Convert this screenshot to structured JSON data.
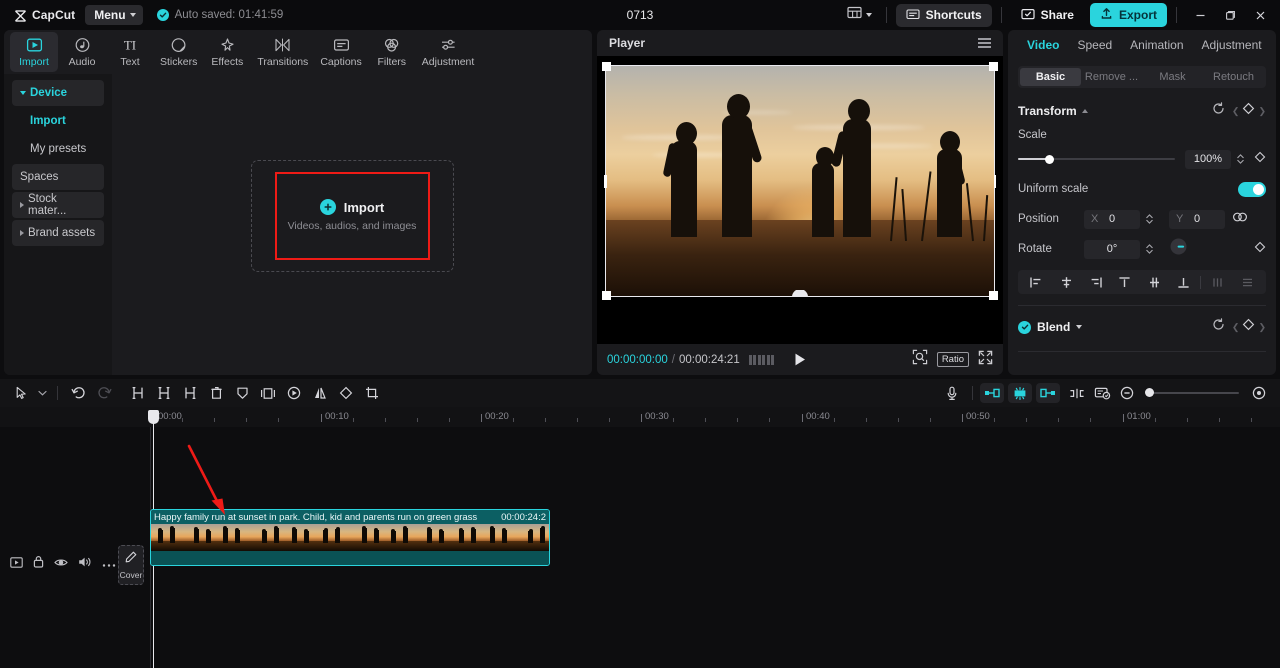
{
  "titlebar": {
    "brand": "CapCut",
    "menu_label": "Menu",
    "autosave_text": "Auto saved: 01:41:59",
    "project_title": "0713",
    "shortcuts_label": "Shortcuts",
    "share_label": "Share",
    "export_label": "Export",
    "icons": {
      "logo": "capcut-logo-icon",
      "autosave_check": "check-circle-icon",
      "layout": "layout-grid-icon",
      "shortcuts": "keyboard-icon",
      "share": "share-box-icon",
      "export": "upload-icon",
      "minimize": "minimize-icon",
      "maximize": "maximize-icon",
      "close": "close-icon"
    }
  },
  "media_tabs": [
    {
      "label": "Import",
      "icon": "import-media-icon",
      "active": true
    },
    {
      "label": "Audio",
      "icon": "audio-note-icon",
      "active": false
    },
    {
      "label": "Text",
      "icon": "text-ti-icon",
      "active": false
    },
    {
      "label": "Stickers",
      "icon": "sticker-icon",
      "active": false
    },
    {
      "label": "Effects",
      "icon": "effects-sparkle-icon",
      "active": false
    },
    {
      "label": "Transitions",
      "icon": "transitions-icon",
      "active": false
    },
    {
      "label": "Captions",
      "icon": "captions-icon",
      "active": false
    },
    {
      "label": "Filters",
      "icon": "filters-circles-icon",
      "active": false
    },
    {
      "label": "Adjustment",
      "icon": "adjustment-sliders-icon",
      "active": false
    }
  ],
  "media_sidebar": [
    {
      "label": "Device",
      "type": "group-open",
      "highlight": true
    },
    {
      "label": "Import",
      "type": "sub",
      "highlight": true
    },
    {
      "label": "My presets",
      "type": "sub",
      "highlight": false
    },
    {
      "label": "Spaces",
      "type": "box",
      "highlight": false
    },
    {
      "label": "Stock mater...",
      "type": "group-closed",
      "highlight": false
    },
    {
      "label": "Brand assets",
      "type": "group-closed",
      "highlight": false
    }
  ],
  "dropzone": {
    "import_label": "Import",
    "import_sub": "Videos, audios, and images",
    "plus_icon": "plus-circle-icon",
    "highlight_color": "#ef1b16"
  },
  "player": {
    "title": "Player",
    "menu_icon": "hamburger-menu-icon",
    "current_time": "00:00:00:00",
    "separator": "/",
    "total_time": "00:00:24:21",
    "frames_icon": "frames-icon",
    "play_icon": "play-icon",
    "zoom_icon": "zoom-fit-icon",
    "ratio_label": "Ratio",
    "fullscreen_icon": "fullscreen-icon"
  },
  "props": {
    "tabs": [
      {
        "label": "Video",
        "active": true
      },
      {
        "label": "Speed",
        "active": false
      },
      {
        "label": "Animation",
        "active": false
      },
      {
        "label": "Adjustment",
        "active": false
      }
    ],
    "subtabs": [
      {
        "label": "Basic",
        "active": true
      },
      {
        "label": "Remove ...",
        "active": false
      },
      {
        "label": "Mask",
        "active": false
      },
      {
        "label": "Retouch",
        "active": false
      }
    ],
    "transform": {
      "title": "Transform",
      "reset_icon": "reset-icon",
      "keyframe_icon": "keyframe-diamond-icon",
      "scale_label": "Scale",
      "scale_value": "100%",
      "scale_percent": 20,
      "uniform_label": "Uniform scale",
      "uniform_on": true,
      "position_label": "Position",
      "pos_x_axis": "X",
      "pos_x_value": "0",
      "pos_y_axis": "Y",
      "pos_y_value": "0",
      "position_link_icon": "link-axes-icon",
      "rotate_label": "Rotate",
      "rotate_value": "0°",
      "rotate_dial_icon": "rotate-dial-icon"
    },
    "align_buttons": [
      "align-left-icon",
      "align-center-h-icon",
      "align-right-icon",
      "align-top-icon",
      "align-middle-v-icon",
      "align-bottom-icon",
      "distribute-h-icon",
      "distribute-v-icon"
    ],
    "blend": {
      "label": "Blend",
      "enabled": true,
      "checkbox_icon": "check-circle-icon",
      "caret_icon": "chevron-down-icon",
      "reset_icon": "reset-icon",
      "keyframe_icon": "keyframe-diamond-icon"
    }
  },
  "timeline": {
    "toolbar_left": [
      "select-cursor-icon",
      "cursor-dropdown-icon",
      "undo-icon",
      "redo-icon",
      "split-left-icon",
      "split-icon",
      "split-right-icon",
      "delete-icon",
      "mask-shield-icon",
      "freeze-frame-icon",
      "speed-icon",
      "mirror-icon",
      "rotate-icon",
      "crop-icon"
    ],
    "toolbar_right": [
      "microphone-icon",
      "snap-left-icon",
      "snap-magnet-icon",
      "snap-right-icon",
      "link-clips-icon",
      "cover-frame-icon",
      "zoom-out-icon",
      "zoom-in-icon"
    ],
    "ruler_labels": [
      "00:00",
      "00:10",
      "00:20",
      "00:30",
      "00:40",
      "00:50",
      "01:00"
    ],
    "track_controls": [
      "video-track-icon",
      "lock-icon",
      "eye-icon",
      "speaker-icon",
      "more-options-icon"
    ],
    "cover_button": {
      "label": "Cover",
      "icon": "pencil-icon"
    },
    "clip": {
      "name": "Happy family run at sunset in park. Child, kid and parents run on green grass",
      "duration": "00:00:24:2",
      "accent_color": "#2ad4dd"
    },
    "annotation_arrow": {
      "icon": "red-arrow-icon",
      "color": "#ee1b17"
    }
  }
}
